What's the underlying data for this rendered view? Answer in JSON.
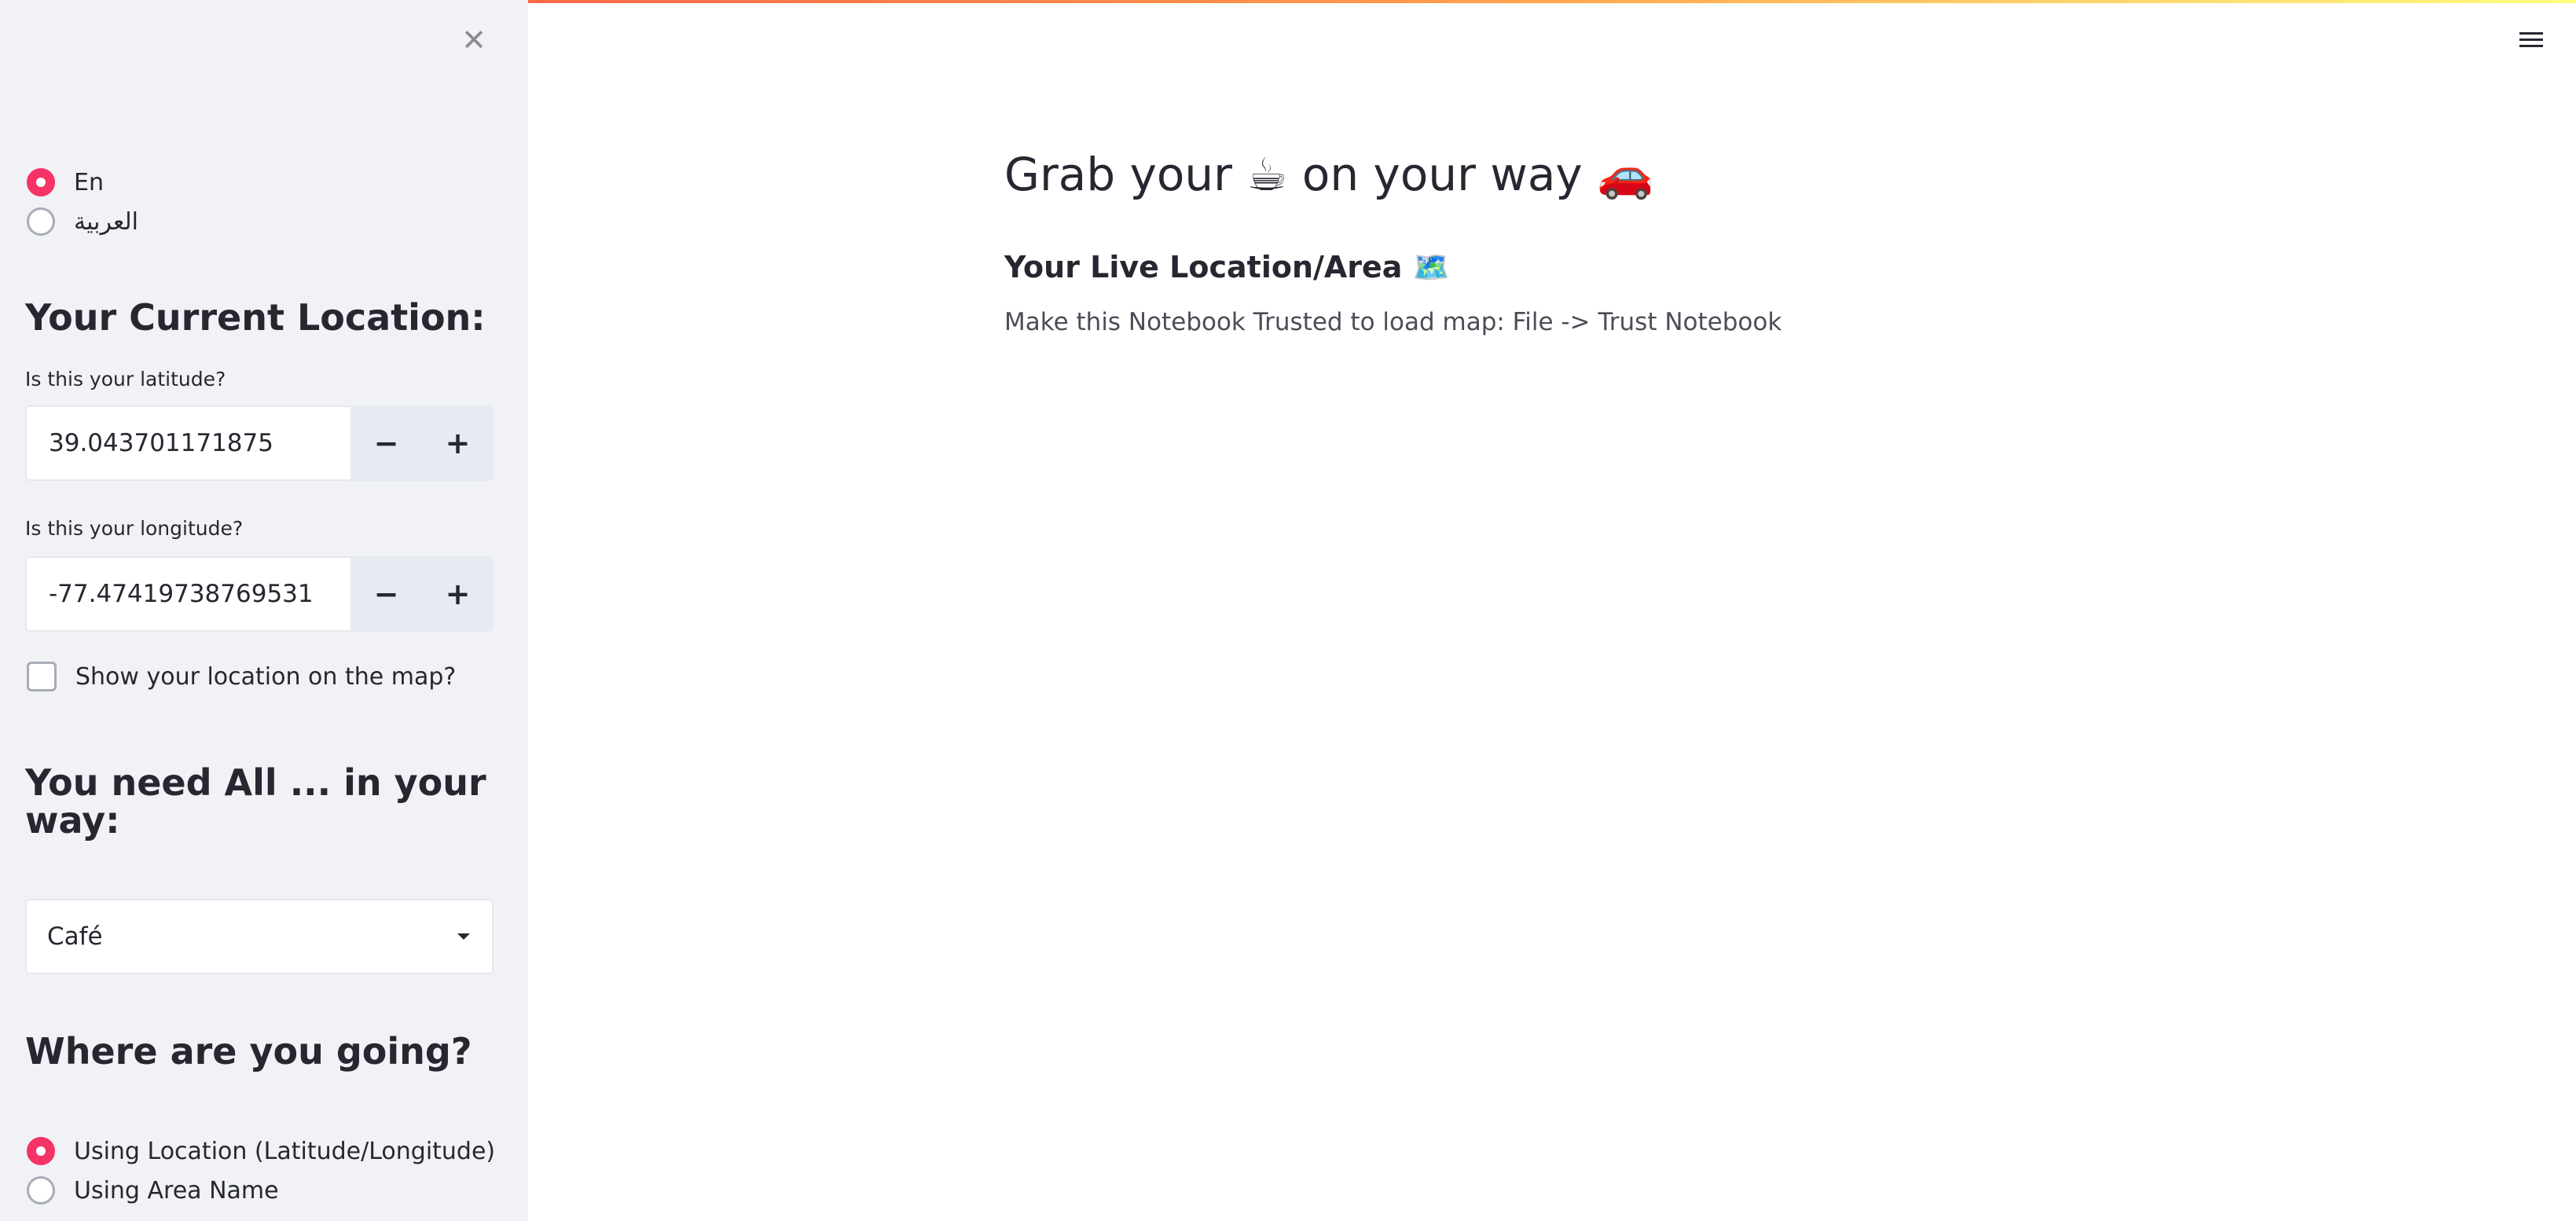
{
  "sidebar": {
    "close_icon": "close-icon",
    "language": {
      "options": [
        "En",
        "العربية"
      ],
      "selected": "En"
    },
    "current_location_heading": "Your Current Location:",
    "latitude": {
      "label": "Is this your latitude?",
      "value": "39.043701171875",
      "decrement": "−",
      "increment": "+"
    },
    "longitude": {
      "label": "Is this your longitude?",
      "value": "-77.47419738769531",
      "decrement": "−",
      "increment": "+"
    },
    "show_map_label": "Show your location on the map?",
    "need_heading": "You need All ... in your way:",
    "place_type": {
      "selected": "Café"
    },
    "going_heading": "Where are you going?",
    "destination": {
      "options": [
        "Using Location (Latitude/Longitude)",
        "Using Area Name"
      ],
      "selected": "Using Location (Latitude/Longitude)"
    }
  },
  "main": {
    "title": "Grab your ☕ on your way 🚗",
    "subtitle": "Your Live Location/Area 🗺️",
    "note": "Make this Notebook Trusted to load map: File -> Trust Notebook"
  },
  "theme": {
    "accent": "#f63366",
    "sidebar_bg": "#f0f2f6",
    "text": "#262730"
  }
}
